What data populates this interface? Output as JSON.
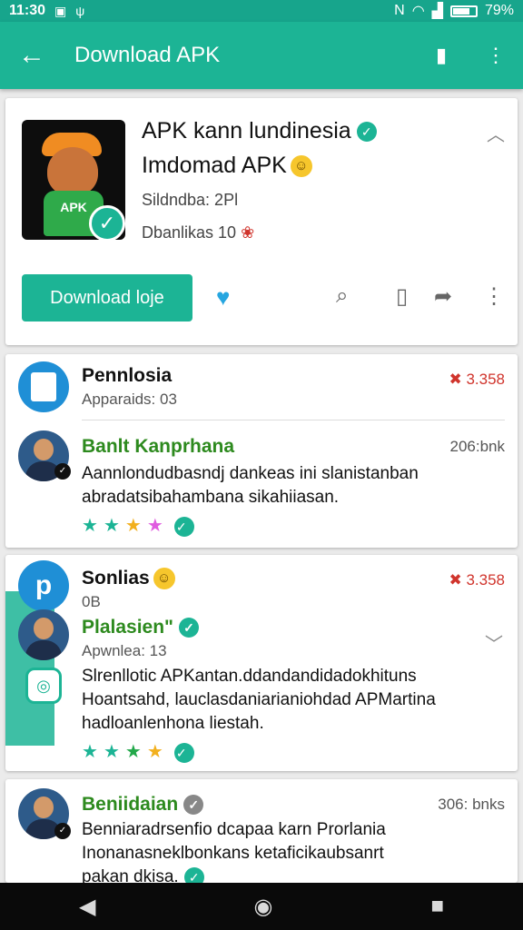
{
  "status_bar": {
    "time": "11:30",
    "battery": "79%",
    "icons": [
      "image-icon",
      "usb-icon",
      "nfc-icon",
      "wifi-icon",
      "signal-icon",
      "battery-icon"
    ]
  },
  "app_bar": {
    "title": "Download APK",
    "icons": [
      "back-arrow-icon",
      "chat-icon",
      "more-vert-icon"
    ]
  },
  "app_card": {
    "name_line1": "APK kann lundinesia",
    "name_line2": "Imdomad APK",
    "icon_text": "APK",
    "meta1": "Sildndba: 2Pl",
    "meta2": "Dbanlikas 10",
    "download_label": "Download loje"
  },
  "reviews": [
    {
      "name": "Pennlosia",
      "sub": "Apparaids: 03",
      "right": "3.358"
    },
    {
      "name": "Banlt Kanprhana",
      "right": "206:bnk",
      "text_line1": "Aannlondudbasndj dankeas ini slanistanban",
      "text_line2": "abradatsibahambana sikahiiasan.",
      "stars": [
        "teal",
        "teal",
        "gold",
        "pink"
      ]
    },
    {
      "name": "Sonlias",
      "sub": "0B",
      "right": "3.358",
      "avatar_letter": "p"
    },
    {
      "name": "Plalasien\"",
      "sub": "Apwnlea: 13",
      "text_line1": "Slrenllotic APKantan.ddandandidadokhituns",
      "text_line2": "Hoantsahd, lauclasdaniarianiohdad APMartina",
      "text_line3": "hadloanlenhona liestah.",
      "stars": [
        "teal",
        "teal",
        "green",
        "gold"
      ]
    },
    {
      "name": "Beniidaian",
      "right": "306: bnks",
      "text_line1": "Benniaradrsenfio dcapaa karn Prorlania",
      "text_line2": "Inonanasneklbonkans ketaficikaubsanrt",
      "text_line3": "pakan dkisa."
    }
  ],
  "nav_bar": {
    "icons": [
      "back-triangle-icon",
      "home-circle-icon",
      "recents-square-icon"
    ]
  }
}
